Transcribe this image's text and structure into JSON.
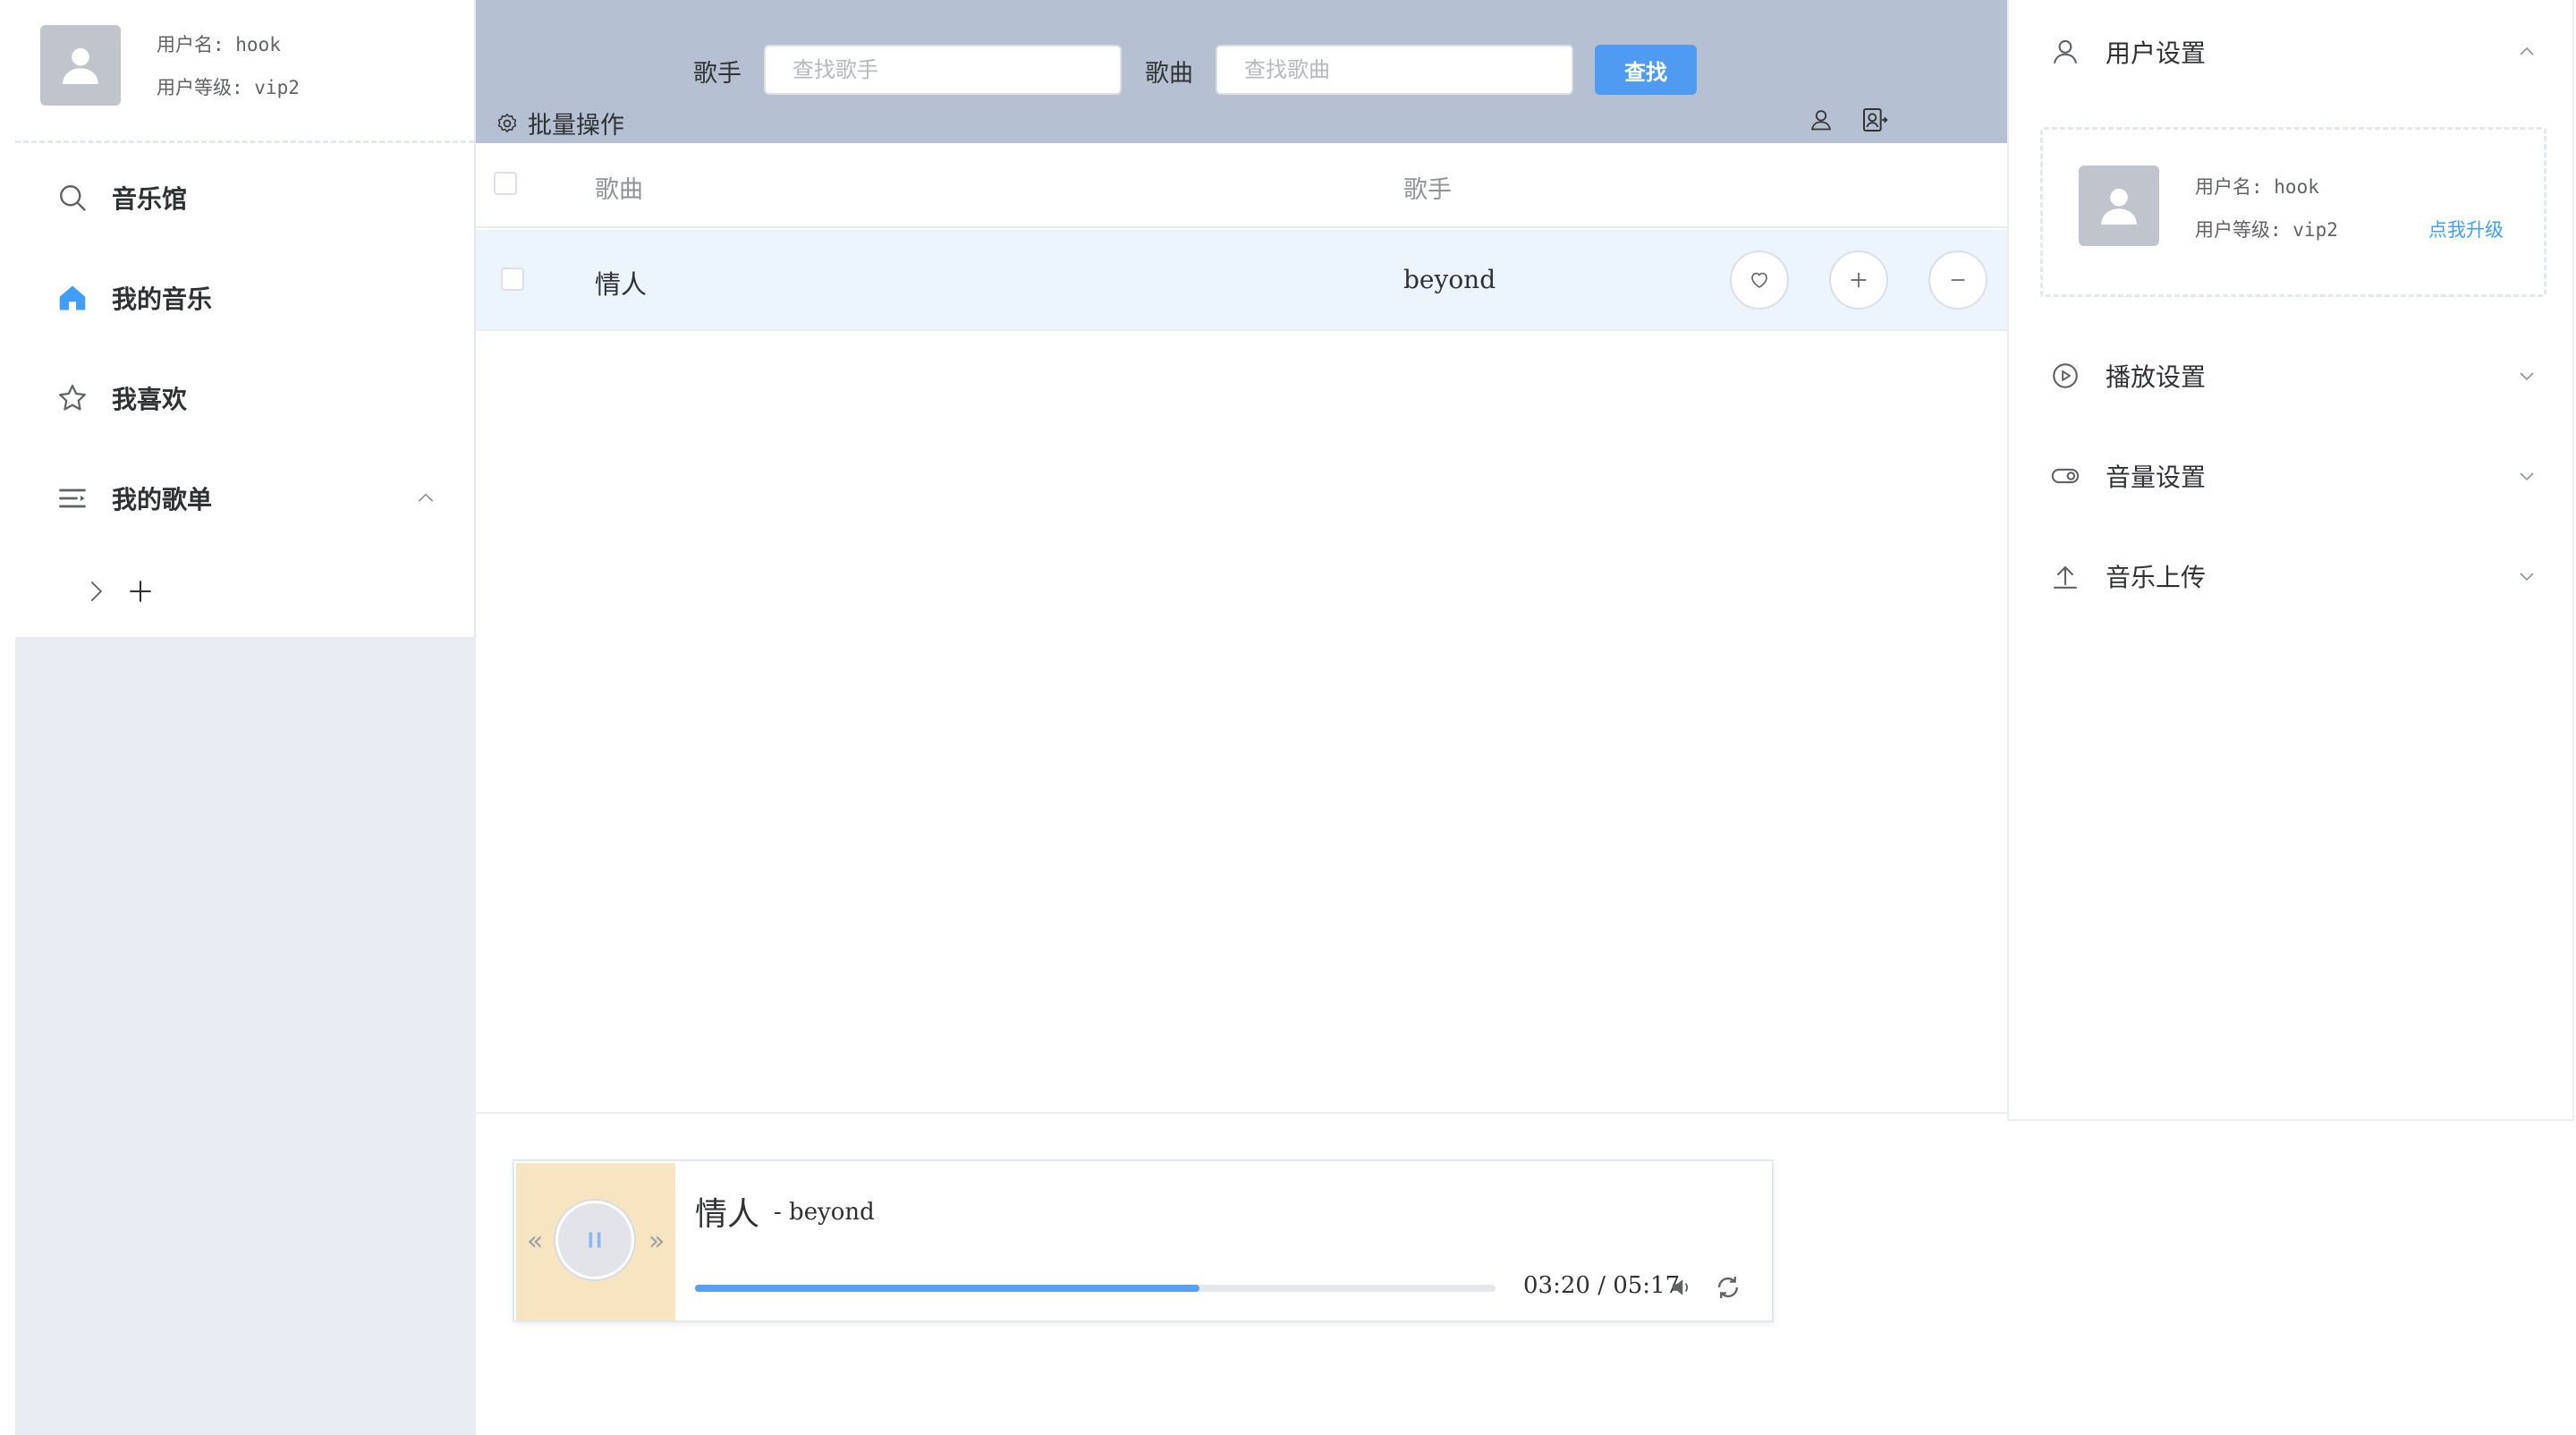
{
  "user": {
    "username_line": "用户名: hook",
    "level_line": "用户等级: vip2",
    "upgrade_label": "点我升级"
  },
  "sidebar": {
    "items": [
      {
        "label": "音乐馆",
        "icon": "search-icon"
      },
      {
        "label": "我的音乐",
        "icon": "home-icon"
      },
      {
        "label": "我喜欢",
        "icon": "star-icon"
      },
      {
        "label": "我的歌单",
        "icon": "playlist-icon"
      }
    ],
    "playlist_expand_icon": "chevron-right-icon",
    "playlist_add_icon": "plus-icon"
  },
  "search": {
    "artist_label": "歌手",
    "artist_placeholder": "查找歌手",
    "song_label": "歌曲",
    "song_placeholder": "查找歌曲",
    "button_label": "查找"
  },
  "toolbar": {
    "batch_label": "批量操作"
  },
  "table": {
    "headers": {
      "song": "歌曲",
      "artist": "歌手"
    },
    "rows": [
      {
        "song": "情人",
        "artist": "beyond"
      }
    ]
  },
  "settings": {
    "sections": [
      {
        "label": "用户设置",
        "icon": "user-icon",
        "expanded": true
      },
      {
        "label": "播放设置",
        "icon": "play-circle-icon",
        "expanded": false
      },
      {
        "label": "音量设置",
        "icon": "toggle-icon",
        "expanded": false
      },
      {
        "label": "音乐上传",
        "icon": "upload-icon",
        "expanded": false
      }
    ]
  },
  "player": {
    "title": "情人",
    "artist": "- beyond",
    "time": "03:20 / 05:17",
    "progress": 0.63,
    "state": "playing",
    "prev_glyph": "«",
    "next_glyph": "»"
  },
  "colors": {
    "accent": "#409eff",
    "top_bar": "#b5c1d2",
    "row_highlight": "#ecf4fe",
    "cover_bg": "#f6e5c0",
    "progress": "#5a9ff0"
  }
}
